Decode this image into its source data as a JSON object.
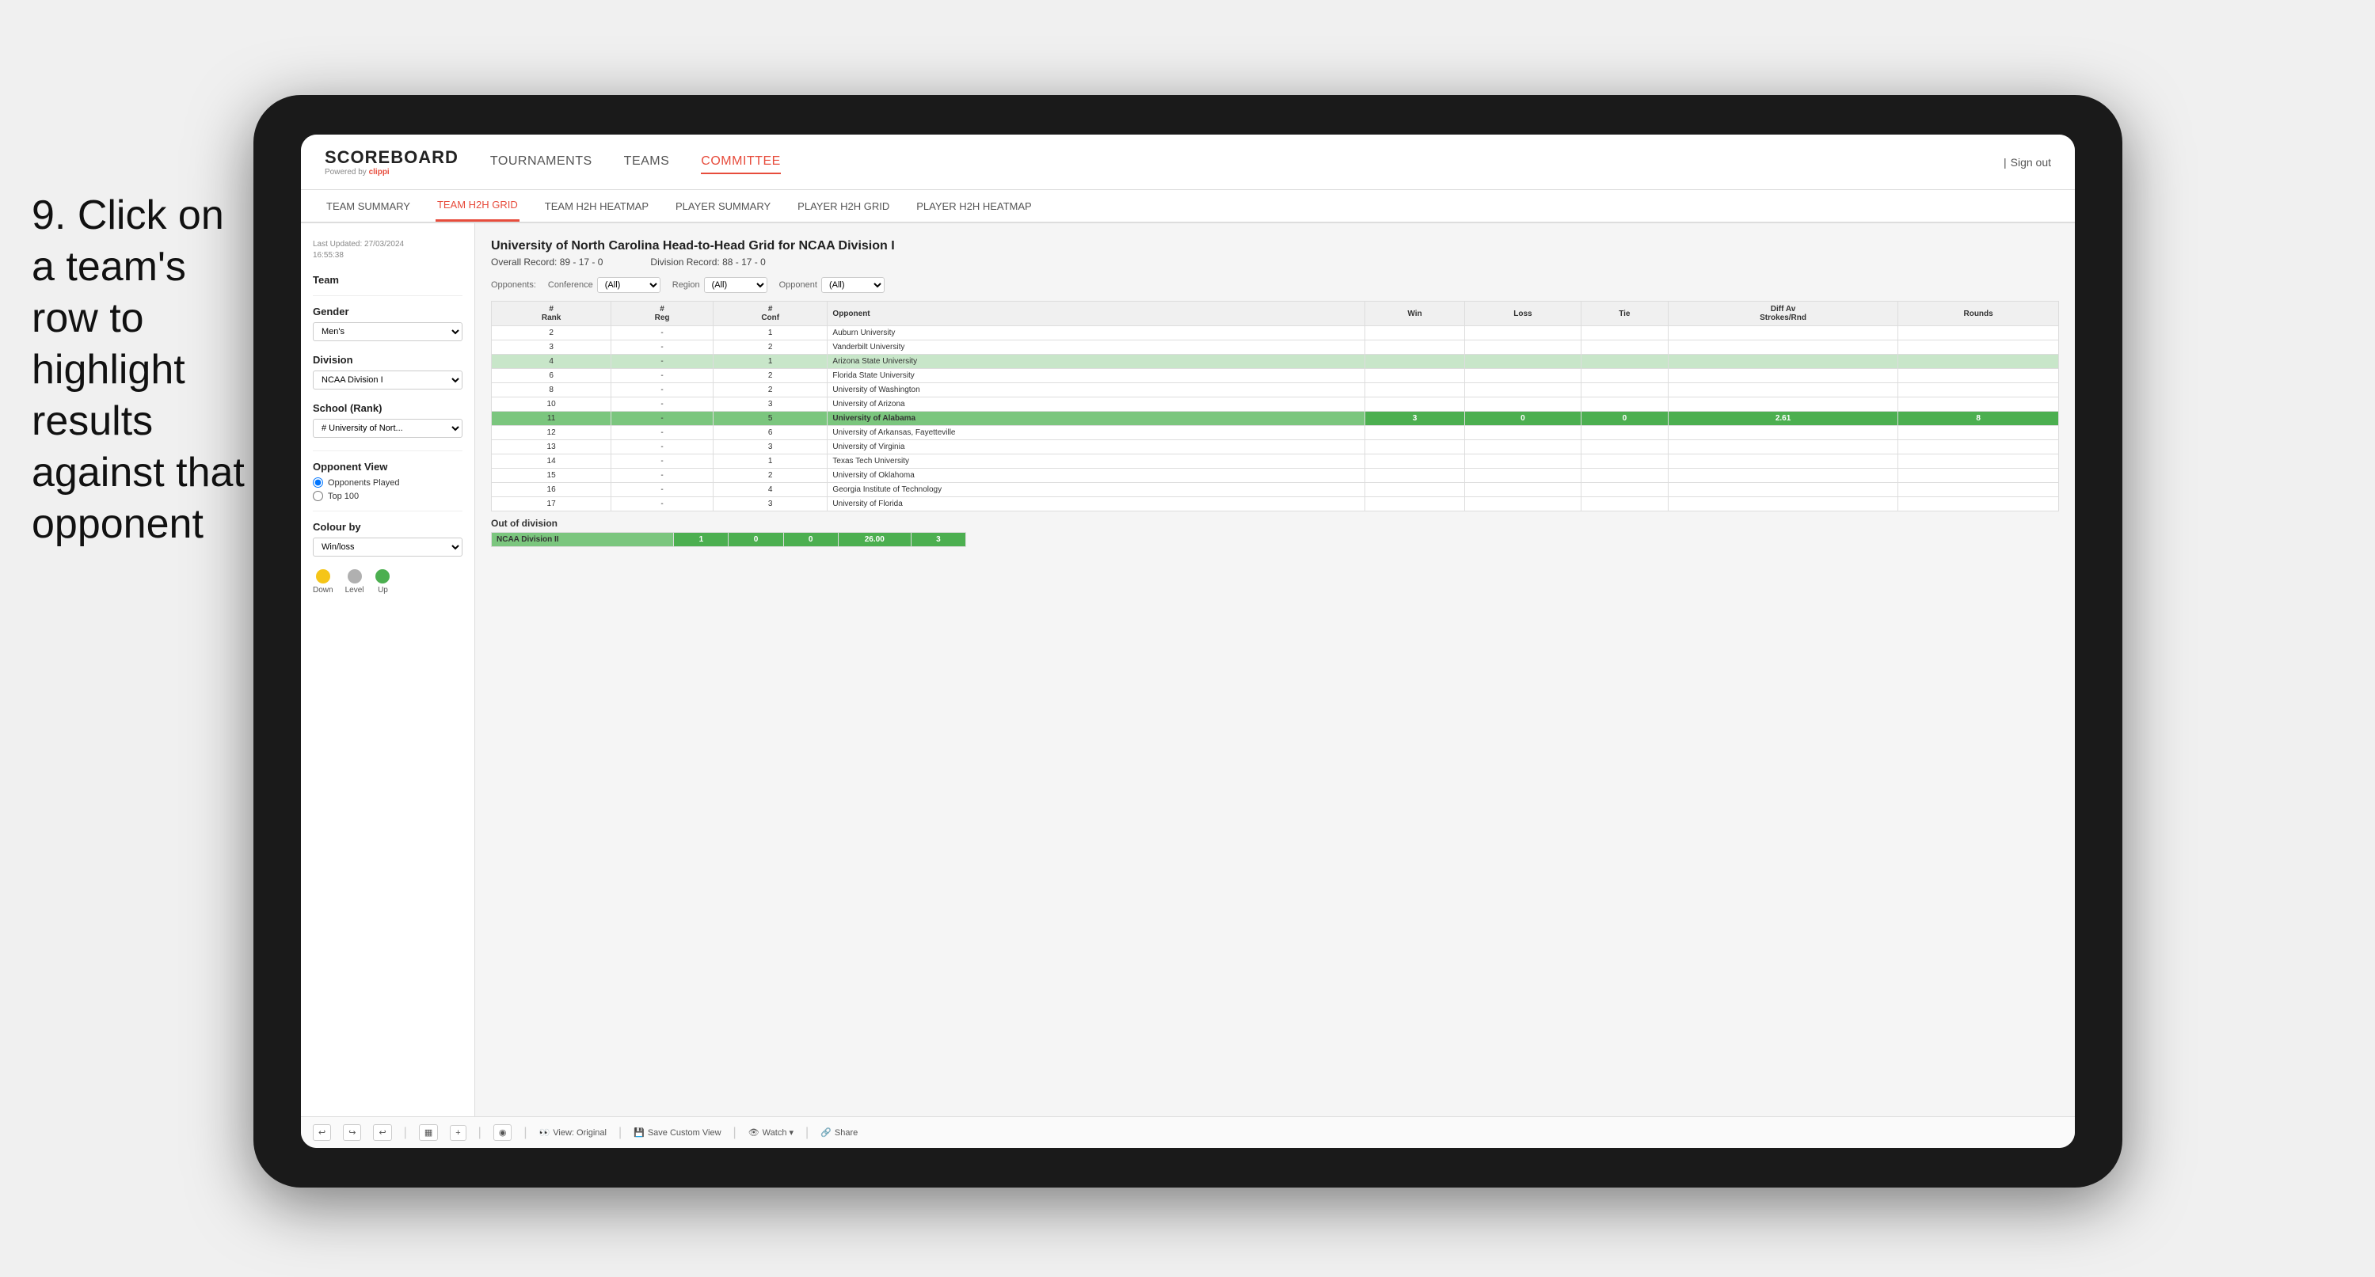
{
  "instruction": {
    "step": "9.",
    "text": "Click on a team's row to highlight results against that opponent"
  },
  "nav": {
    "logo": "SCOREBOARD",
    "powered_by": "Powered by",
    "brand": "clippi",
    "items": [
      {
        "label": "TOURNAMENTS",
        "active": false
      },
      {
        "label": "TEAMS",
        "active": false
      },
      {
        "label": "COMMITTEE",
        "active": true
      }
    ],
    "sign_out": "Sign out"
  },
  "sub_nav": {
    "items": [
      {
        "label": "TEAM SUMMARY",
        "active": false
      },
      {
        "label": "TEAM H2H GRID",
        "active": true
      },
      {
        "label": "TEAM H2H HEATMAP",
        "active": false
      },
      {
        "label": "PLAYER SUMMARY",
        "active": false
      },
      {
        "label": "PLAYER H2H GRID",
        "active": false
      },
      {
        "label": "PLAYER H2H HEATMAP",
        "active": false
      }
    ]
  },
  "sidebar": {
    "last_updated_label": "Last Updated: 27/03/2024",
    "time": "16:55:38",
    "team_label": "Team",
    "gender_label": "Gender",
    "gender_value": "Men's",
    "division_label": "Division",
    "division_value": "NCAA Division I",
    "school_label": "School (Rank)",
    "school_value": "# University of Nort...",
    "opponent_view_label": "Opponent View",
    "radio_opponents": "Opponents Played",
    "radio_top100": "Top 100",
    "colour_by_label": "Colour by",
    "colour_by_value": "Win/loss",
    "legend": [
      {
        "label": "Down",
        "color": "#f5c518"
      },
      {
        "label": "Level",
        "color": "#b0b0b0"
      },
      {
        "label": "Up",
        "color": "#4caf50"
      }
    ]
  },
  "grid": {
    "title": "University of North Carolina Head-to-Head Grid for NCAA Division I",
    "overall_record": "Overall Record: 89 - 17 - 0",
    "division_record": "Division Record: 88 - 17 - 0",
    "filters": {
      "opponents_label": "Opponents:",
      "conference_label": "Conference",
      "conference_value": "(All)",
      "region_label": "Region",
      "region_value": "(All)",
      "opponent_label": "Opponent",
      "opponent_value": "(All)"
    },
    "columns": [
      {
        "label": "#\nRank"
      },
      {
        "label": "#\nReg"
      },
      {
        "label": "#\nConf"
      },
      {
        "label": "Opponent"
      },
      {
        "label": "Win"
      },
      {
        "label": "Loss"
      },
      {
        "label": "Tie"
      },
      {
        "label": "Diff Av\nStrokes/Rnd"
      },
      {
        "label": "Rounds"
      }
    ],
    "rows": [
      {
        "rank": "2",
        "reg": "-",
        "conf": "1",
        "opponent": "Auburn University",
        "win": "",
        "loss": "",
        "tie": "",
        "diff": "",
        "rounds": "",
        "style": "normal"
      },
      {
        "rank": "3",
        "reg": "-",
        "conf": "2",
        "opponent": "Vanderbilt University",
        "win": "",
        "loss": "",
        "tie": "",
        "diff": "",
        "rounds": "",
        "style": "normal"
      },
      {
        "rank": "4",
        "reg": "-",
        "conf": "1",
        "opponent": "Arizona State University",
        "win": "",
        "loss": "",
        "tie": "",
        "diff": "",
        "rounds": "",
        "style": "light-green"
      },
      {
        "rank": "6",
        "reg": "-",
        "conf": "2",
        "opponent": "Florida State University",
        "win": "",
        "loss": "",
        "tie": "",
        "diff": "",
        "rounds": "",
        "style": "normal"
      },
      {
        "rank": "8",
        "reg": "-",
        "conf": "2",
        "opponent": "University of Washington",
        "win": "",
        "loss": "",
        "tie": "",
        "diff": "",
        "rounds": "",
        "style": "normal"
      },
      {
        "rank": "10",
        "reg": "-",
        "conf": "3",
        "opponent": "University of Arizona",
        "win": "",
        "loss": "",
        "tie": "",
        "diff": "",
        "rounds": "",
        "style": "normal"
      },
      {
        "rank": "11",
        "reg": "-",
        "conf": "5",
        "opponent": "University of Alabama",
        "win": "3",
        "loss": "0",
        "tie": "0",
        "diff": "2.61",
        "rounds": "8",
        "style": "selected"
      },
      {
        "rank": "12",
        "reg": "-",
        "conf": "6",
        "opponent": "University of Arkansas, Fayetteville",
        "win": "",
        "loss": "",
        "tie": "",
        "diff": "",
        "rounds": "",
        "style": "normal"
      },
      {
        "rank": "13",
        "reg": "-",
        "conf": "3",
        "opponent": "University of Virginia",
        "win": "",
        "loss": "",
        "tie": "",
        "diff": "",
        "rounds": "",
        "style": "normal"
      },
      {
        "rank": "14",
        "reg": "-",
        "conf": "1",
        "opponent": "Texas Tech University",
        "win": "",
        "loss": "",
        "tie": "",
        "diff": "",
        "rounds": "",
        "style": "normal"
      },
      {
        "rank": "15",
        "reg": "-",
        "conf": "2",
        "opponent": "University of Oklahoma",
        "win": "",
        "loss": "",
        "tie": "",
        "diff": "",
        "rounds": "",
        "style": "normal"
      },
      {
        "rank": "16",
        "reg": "-",
        "conf": "4",
        "opponent": "Georgia Institute of Technology",
        "win": "",
        "loss": "",
        "tie": "",
        "diff": "",
        "rounds": "",
        "style": "normal"
      },
      {
        "rank": "17",
        "reg": "-",
        "conf": "3",
        "opponent": "University of Florida",
        "win": "",
        "loss": "",
        "tie": "",
        "diff": "",
        "rounds": "",
        "style": "normal"
      }
    ],
    "out_of_division_label": "Out of division",
    "out_of_division_row": {
      "division": "NCAA Division II",
      "win": "1",
      "loss": "0",
      "tie": "0",
      "diff": "26.00",
      "rounds": "3"
    }
  },
  "toolbar": {
    "undo": "↩",
    "redo": "↪",
    "view_original": "View: Original",
    "save_custom": "Save Custom View",
    "watch": "Watch ▾",
    "share": "Share"
  }
}
